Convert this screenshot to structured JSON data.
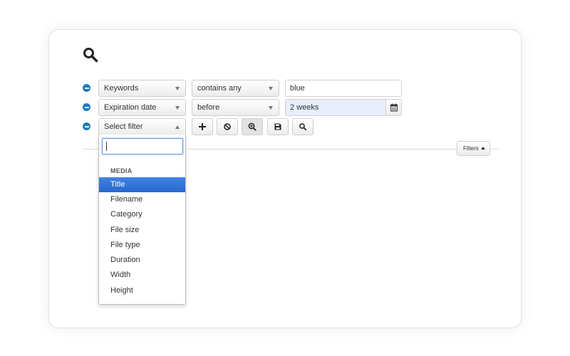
{
  "header": {
    "icon": "search-icon"
  },
  "filters": [
    {
      "field": "Keywords",
      "operator": "contains any",
      "value": "blue"
    },
    {
      "field": "Expiration date",
      "operator": "before",
      "value": "2 weeks"
    }
  ],
  "new_filter": {
    "placeholder": "Select filter"
  },
  "toolbar": {
    "icons": [
      "plus-icon",
      "ban-icon",
      "zoom-in-icon",
      "save-icon",
      "search-icon"
    ]
  },
  "filters_toggle": {
    "label": "Filters"
  },
  "dropdown": {
    "search_value": "",
    "group_label": "MEDIA",
    "items": [
      "Title",
      "Filename",
      "Category",
      "File size",
      "File type",
      "Duration",
      "Width",
      "Height"
    ],
    "selected": "Title"
  },
  "colors": {
    "accent": "#1a7bbf",
    "selected_item": "#3875d7",
    "highlight_input": "#e8eefb"
  }
}
